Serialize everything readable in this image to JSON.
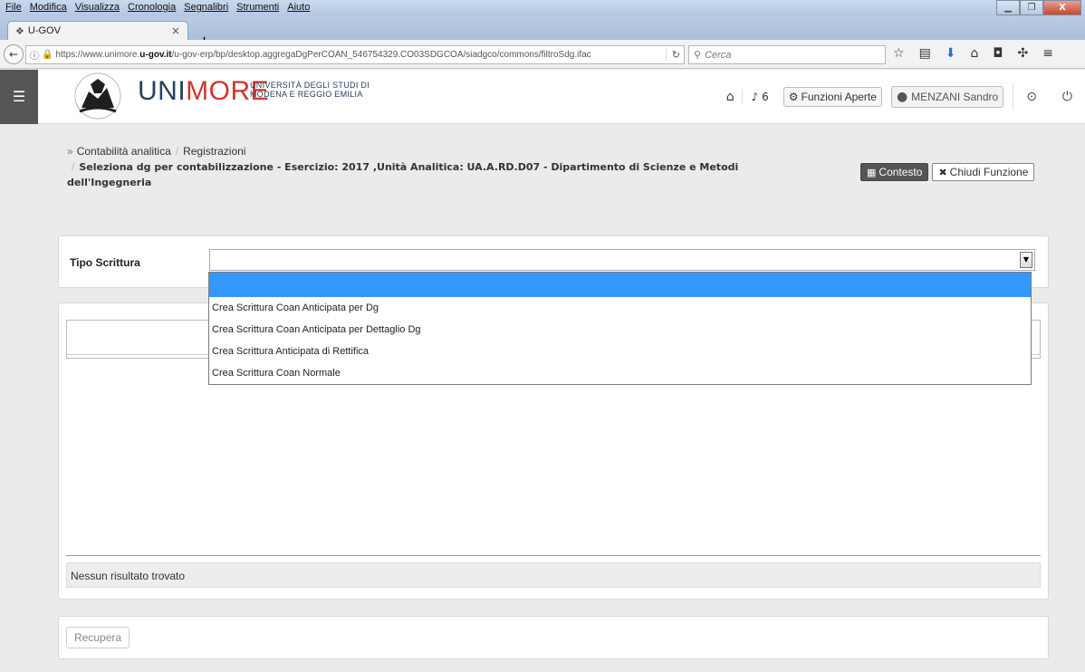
{
  "browser": {
    "menu": [
      "File",
      "Modifica",
      "Visualizza",
      "Cronologia",
      "Segnalibri",
      "Strumenti",
      "Aiuto"
    ],
    "tab_title": "U-GOV",
    "url_prefix": "https://www.unimore.",
    "url_domain": "u-gov.it",
    "url_rest": "/u-gov-erp/bp/desktop.aggregaDgPerCOAN_546754329.CO03SDGCOA/siadgco/commons/filtroSdg.ifac",
    "search_placeholder": "Cerca"
  },
  "header": {
    "logo_uni": "UNI",
    "logo_more": "MORE",
    "logo_sub_line1": "UNIVERSITÀ DEGLI STUDI DI",
    "logo_sub_line2": "MODENA E REGGIO EMILIA",
    "notifications_count": "6",
    "funzioni_label": "Funzioni Aperte",
    "user_name": "MENZANI Sandro"
  },
  "breadcrumb": {
    "item1": "Contabilità analitica",
    "item2": "Registrazioni",
    "title": "Seleziona dg per contabilizzazione - Esercizio: 2017 ,Unità Analitica: UA.A.RD.D07 - Dipartimento di Scienze e Metodi dell'Ingegneria"
  },
  "context_buttons": {
    "contesto": "Contesto",
    "chiudi": "Chiudi Funzione"
  },
  "filter": {
    "label": "Tipo Scrittura",
    "selected_value": "",
    "options": [
      "",
      "Crea Scrittura Coan Anticipata per Dg",
      "Crea Scrittura Coan Anticipata per Dettaglio Dg",
      "Crea Scrittura Anticipata di Rettifica",
      "Crea Scrittura Coan Normale"
    ]
  },
  "results": {
    "empty_message": "Nessun risultato trovato"
  },
  "actions": {
    "recupera": "Recupera"
  }
}
